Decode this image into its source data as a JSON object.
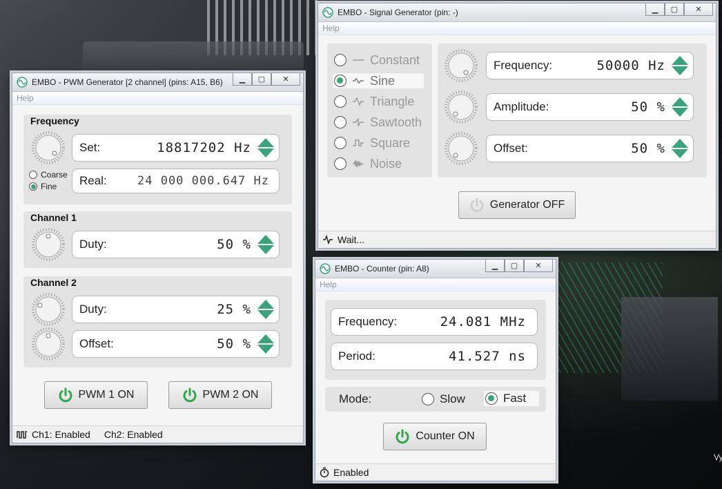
{
  "pwm": {
    "title": "EMBO - PWM Generator [2 channel] (pins: A15, B6)",
    "menu": "Help",
    "frequency_title": "Frequency",
    "set_label": "Set:",
    "set_value": "18817202 Hz",
    "real_label": "Real:",
    "real_value": "24 000 000.647 Hz",
    "coarse": "Coarse",
    "fine": "Fine",
    "fine_selected": true,
    "ch1_title": "Channel 1",
    "ch1_duty_label": "Duty:",
    "ch1_duty_value": "50 %",
    "ch2_title": "Channel 2",
    "ch2_duty_label": "Duty:",
    "ch2_duty_value": "25 %",
    "ch2_offset_label": "Offset:",
    "ch2_offset_value": "50 %",
    "btn1": "PWM 1 ON",
    "btn2": "PWM 2 ON",
    "status_ch1": "Ch1: Enabled",
    "status_ch2": "Ch2: Enabled"
  },
  "sig": {
    "title": "EMBO - Signal Generator (pin: -)",
    "menu": "Help",
    "waveforms": [
      {
        "label": "Constant",
        "icon": "constant-wave-icon"
      },
      {
        "label": "Sine",
        "icon": "sine-wave-icon"
      },
      {
        "label": "Triangle",
        "icon": "triangle-wave-icon"
      },
      {
        "label": "Sawtooth",
        "icon": "sawtooth-wave-icon"
      },
      {
        "label": "Square",
        "icon": "square-wave-icon"
      },
      {
        "label": "Noise",
        "icon": "noise-wave-icon"
      }
    ],
    "selected_waveform": "Sine",
    "freq_label": "Frequency:",
    "freq_value": "50000 Hz",
    "amp_label": "Amplitude:",
    "amp_value": "50 %",
    "offset_label": "Offset:",
    "offset_value": "50 %",
    "button": "Generator OFF",
    "status": "Wait..."
  },
  "counter": {
    "title": "EMBO - Counter (pin: A8)",
    "menu": "Help",
    "freq_label": "Frequency:",
    "freq_value": "24.081 MHz",
    "period_label": "Period:",
    "period_value": "41.527 ns",
    "mode_label": "Mode:",
    "slow": "Slow",
    "fast": "Fast",
    "mode_selected": "Fast",
    "button": "Counter ON",
    "status": "Enabled"
  },
  "desktop_text": "Vy",
  "colors": {
    "accent": "#3aa37a",
    "power": "#2ea84a"
  }
}
